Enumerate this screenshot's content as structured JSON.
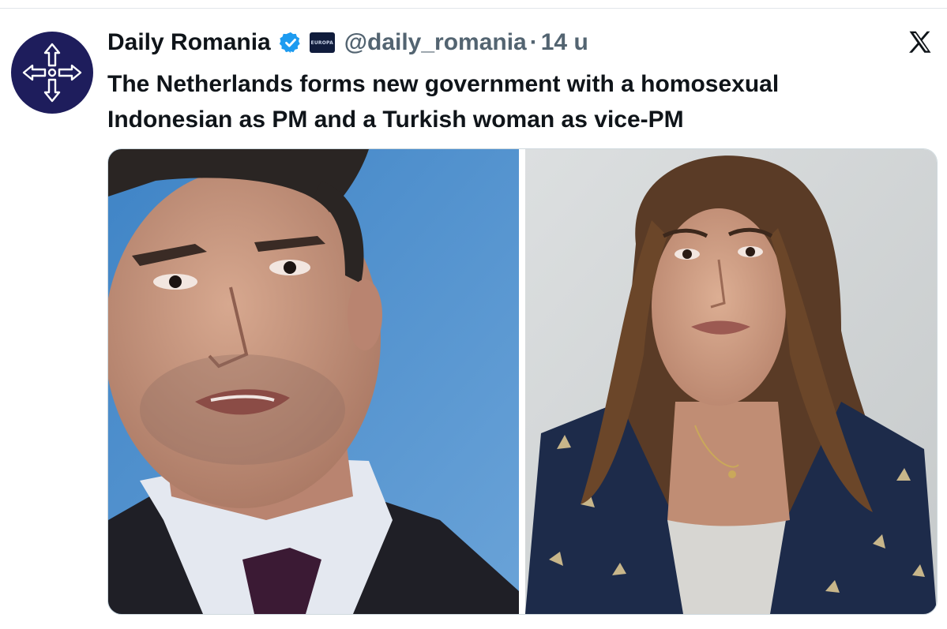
{
  "account": {
    "name": "Daily Romania",
    "handle": "@daily_romania",
    "separator": "·",
    "time": "14 u",
    "affiliate_badge_text": "EUROPA"
  },
  "tweet": {
    "text": "The Netherlands forms new government with a homosexual Indonesian as PM and a Turkish woman as vice-PM"
  },
  "media": {
    "images": [
      {
        "subject": "man in suit against blue background"
      },
      {
        "subject": "woman with long brown hair against light background"
      }
    ]
  },
  "icons": {
    "avatar": "cross-logo-icon",
    "verified": "verified-check-icon",
    "platform": "x-logo-icon"
  },
  "colors": {
    "avatar_bg": "#1e1d5c",
    "verified_blue": "#1d9bf0",
    "muted_text": "#536471",
    "text": "#0f1419"
  }
}
